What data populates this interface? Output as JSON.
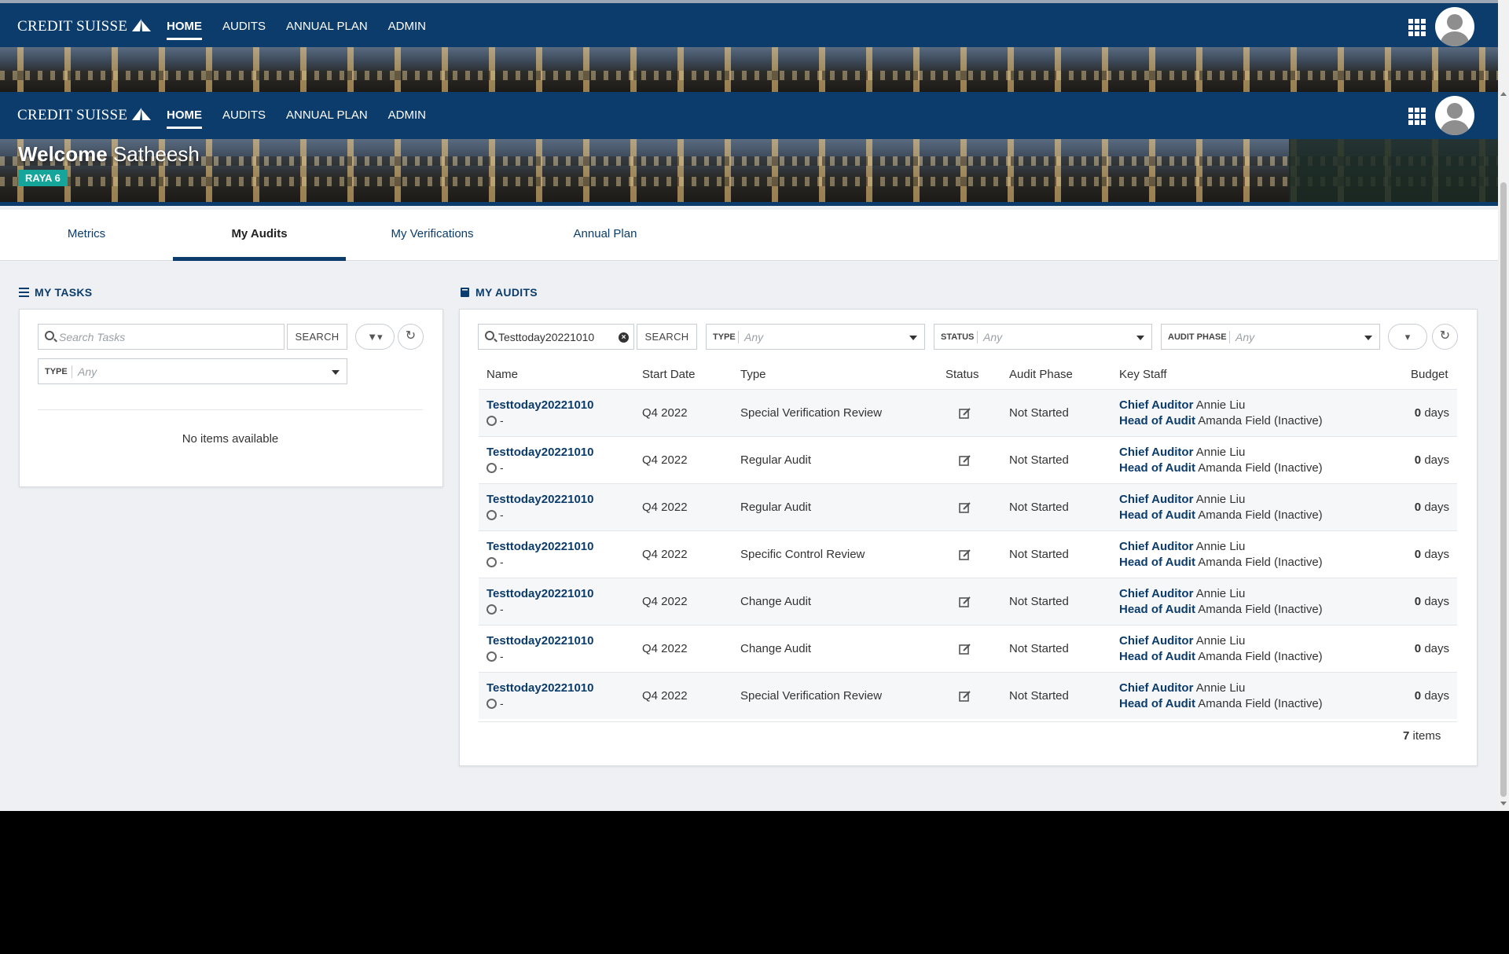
{
  "brand": {
    "name": "CREDIT SUISSE"
  },
  "nav": {
    "items": [
      {
        "label": "HOME",
        "active": true
      },
      {
        "label": "AUDITS"
      },
      {
        "label": "ANNUAL PLAN"
      },
      {
        "label": "ADMIN"
      }
    ]
  },
  "welcome": {
    "greeting": "Welcome",
    "name": "Satheesh",
    "badge": "RAYA 6"
  },
  "tabs": [
    {
      "label": "Metrics"
    },
    {
      "label": "My Audits",
      "active": true
    },
    {
      "label": "My Verifications"
    },
    {
      "label": "Annual Plan"
    }
  ],
  "tasks": {
    "title": "MY TASKS",
    "search_placeholder": "Search Tasks",
    "search_button": "SEARCH",
    "type_label": "TYPE",
    "type_value": "Any",
    "empty_text": "No items available"
  },
  "audits": {
    "title": "MY AUDITS",
    "search_value": "Testtoday20221010",
    "search_button": "SEARCH",
    "filters": [
      {
        "label": "TYPE",
        "value": "Any"
      },
      {
        "label": "STATUS",
        "value": "Any"
      },
      {
        "label": "AUDIT PHASE",
        "value": "Any"
      }
    ],
    "columns": {
      "name": "Name",
      "start_date": "Start Date",
      "type": "Type",
      "status": "Status",
      "audit_phase": "Audit Phase",
      "key_staff": "Key Staff",
      "budget": "Budget"
    },
    "rows": [
      {
        "name": "Testtoday20221010",
        "owner": "-",
        "start_date": "Q4 2022",
        "type": "Special Verification Review",
        "phase": "Not Started",
        "chief_label": "Chief Auditor",
        "chief": "Annie Liu",
        "head_label": "Head of Audit",
        "head": "Amanda Field (Inactive)",
        "budget": "0",
        "budget_unit": "days"
      },
      {
        "name": "Testtoday20221010",
        "owner": "-",
        "start_date": "Q4 2022",
        "type": "Regular Audit",
        "phase": "Not Started",
        "chief_label": "Chief Auditor",
        "chief": "Annie Liu",
        "head_label": "Head of Audit",
        "head": "Amanda Field (Inactive)",
        "budget": "0",
        "budget_unit": "days"
      },
      {
        "name": "Testtoday20221010",
        "owner": "-",
        "start_date": "Q4 2022",
        "type": "Regular Audit",
        "phase": "Not Started",
        "chief_label": "Chief Auditor",
        "chief": "Annie Liu",
        "head_label": "Head of Audit",
        "head": "Amanda Field (Inactive)",
        "budget": "0",
        "budget_unit": "days"
      },
      {
        "name": "Testtoday20221010",
        "owner": "-",
        "start_date": "Q4 2022",
        "type": "Specific Control Review",
        "phase": "Not Started",
        "chief_label": "Chief Auditor",
        "chief": "Annie Liu",
        "head_label": "Head of Audit",
        "head": "Amanda Field (Inactive)",
        "budget": "0",
        "budget_unit": "days"
      },
      {
        "name": "Testtoday20221010",
        "owner": "-",
        "start_date": "Q4 2022",
        "type": "Change Audit",
        "phase": "Not Started",
        "chief_label": "Chief Auditor",
        "chief": "Annie Liu",
        "head_label": "Head of Audit",
        "head": "Amanda Field (Inactive)",
        "budget": "0",
        "budget_unit": "days"
      },
      {
        "name": "Testtoday20221010",
        "owner": "-",
        "start_date": "Q4 2022",
        "type": "Change Audit",
        "phase": "Not Started",
        "chief_label": "Chief Auditor",
        "chief": "Annie Liu",
        "head_label": "Head of Audit",
        "head": "Amanda Field (Inactive)",
        "budget": "0",
        "budget_unit": "days"
      },
      {
        "name": "Testtoday20221010",
        "owner": "-",
        "start_date": "Q4 2022",
        "type": "Special Verification Review",
        "phase": "Not Started",
        "chief_label": "Chief Auditor",
        "chief": "Annie Liu",
        "head_label": "Head of Audit",
        "head": "Amanda Field (Inactive)",
        "budget": "0",
        "budget_unit": "days"
      }
    ],
    "count": "7",
    "count_label": "items"
  },
  "colors": {
    "brand_navy": "#0b3c6b",
    "badge_teal": "#16a59b",
    "page_bg": "#eef0f3"
  }
}
